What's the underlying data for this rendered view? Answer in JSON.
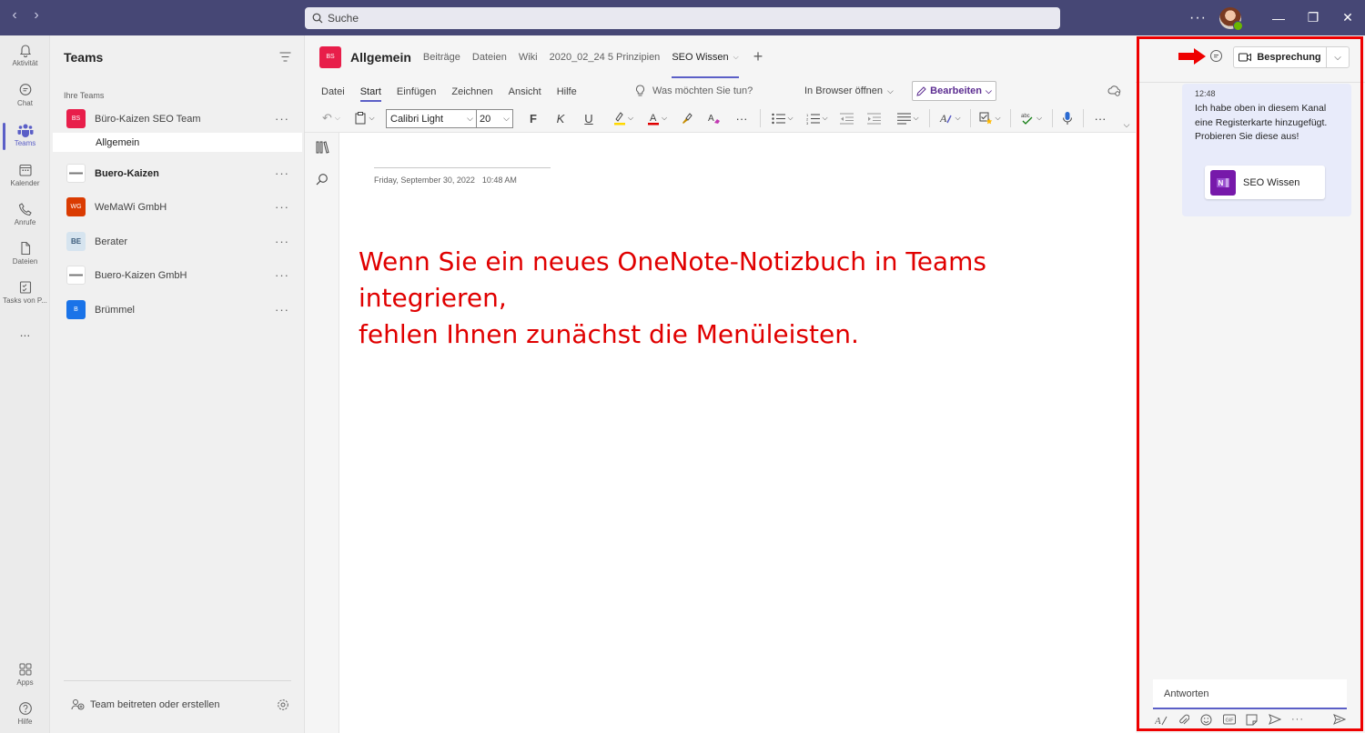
{
  "titlebar": {
    "search_placeholder": "Suche",
    "more": "···"
  },
  "rail": {
    "items": [
      {
        "label": "Aktivität",
        "icon": "bell-icon"
      },
      {
        "label": "Chat",
        "icon": "chat-icon"
      },
      {
        "label": "Teams",
        "icon": "teams-icon"
      },
      {
        "label": "Kalender",
        "icon": "calendar-icon"
      },
      {
        "label": "Anrufe",
        "icon": "phone-icon"
      },
      {
        "label": "Dateien",
        "icon": "file-icon"
      },
      {
        "label": "Tasks von P...",
        "icon": "tasks-icon"
      },
      {
        "label": "...",
        "icon": "more-icon"
      },
      {
        "label": "Apps",
        "icon": "apps-icon"
      },
      {
        "label": "Hilfe",
        "icon": "help-icon"
      }
    ],
    "active": "Teams"
  },
  "teams_panel": {
    "title": "Teams",
    "section": "Ihre Teams",
    "teams": [
      {
        "badge": "BS",
        "name": "Büro-Kaizen SEO Team",
        "bold": false,
        "color": "#e81e4a"
      },
      {
        "badge": "",
        "name": "Buero-Kaizen",
        "bold": true,
        "color": "#ffffff"
      },
      {
        "badge": "WG",
        "name": "WeMaWi GmbH",
        "bold": false,
        "color": "#da3b01"
      },
      {
        "badge": "BE",
        "name": "Berater",
        "bold": false,
        "color": "#d6e4ef"
      },
      {
        "badge": "",
        "name": "Buero-Kaizen GmbH",
        "bold": false,
        "color": "#ffffff"
      },
      {
        "badge": "B",
        "name": "Brümmel",
        "bold": false,
        "color": "#1a73e8"
      }
    ],
    "selected_channel": "Allgemein",
    "more": "···",
    "join_label": "Team beitreten oder erstellen"
  },
  "channel": {
    "badge": "BS",
    "name": "Allgemein",
    "tabs": [
      "Beiträge",
      "Dateien",
      "Wiki",
      "2020_02_24 5 Prinzipien",
      "SEO Wissen"
    ],
    "active_tab": "SEO Wissen"
  },
  "ribbon": {
    "tabs": [
      "Datei",
      "Start",
      "Einfügen",
      "Zeichnen",
      "Ansicht",
      "Hilfe"
    ],
    "active_tab": "Start",
    "tell_me": "Was möchten Sie tun?",
    "browser_open": "In Browser öffnen",
    "edit": "Bearbeiten",
    "font": "Calibri Light",
    "font_size": "20",
    "bold": "F",
    "italic": "K",
    "underline": "U",
    "more": "···"
  },
  "page": {
    "date": "Friday, September 30, 2022",
    "time": "10:48 AM",
    "note_line1": "Wenn Sie ein neues OneNote-Notizbuch in Teams integrieren,",
    "note_line2": "fehlen Ihnen zunächst die Menüleisten."
  },
  "right_pane": {
    "meeting_label": "Besprechung",
    "message_time": "12:48",
    "message_text": "Ich habe oben in diesem Kanal eine Registerkarte hinzugefügt. Probieren Sie diese aus!",
    "card_label": "SEO Wissen",
    "reply_placeholder": "Antworten",
    "more": "···"
  },
  "colors": {
    "titlebar": "#464775",
    "accent": "#5b5fc7",
    "annotation_red": "#ee0000",
    "onenote_purple": "#7719aa"
  }
}
